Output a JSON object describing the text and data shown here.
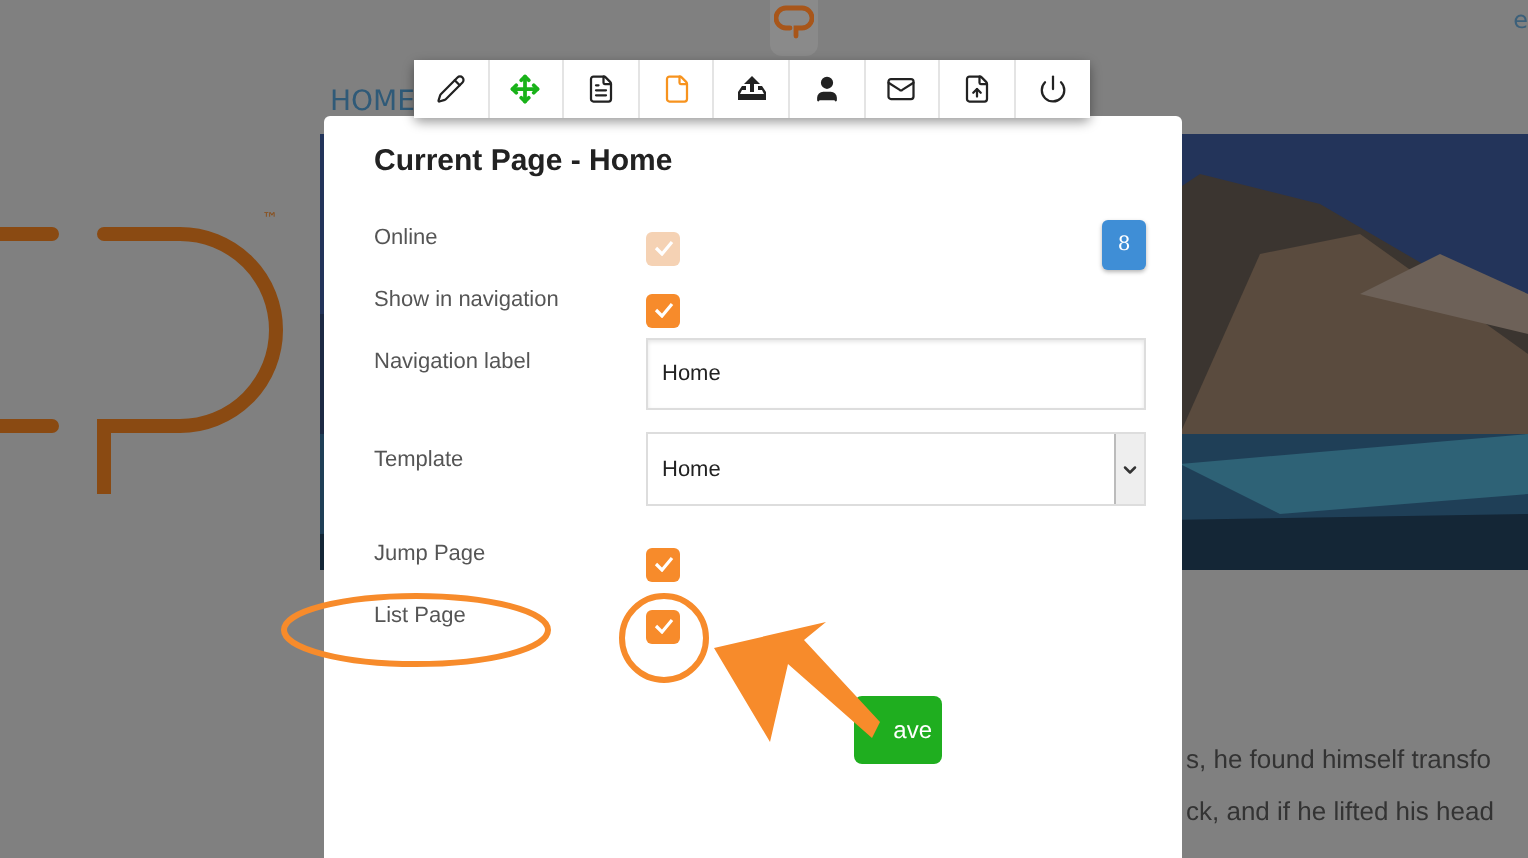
{
  "page": {
    "corner_text": "e",
    "nav_link": "HOME",
    "trademark": "™",
    "text_lines": [
      "s, he found himself transfo",
      "ck, and if he lifted his head"
    ]
  },
  "toolbar": [
    {
      "kind": "edit",
      "selected": false
    },
    {
      "kind": "move",
      "selected": false
    },
    {
      "kind": "document",
      "selected": false
    },
    {
      "kind": "page",
      "selected": true
    },
    {
      "kind": "upload",
      "selected": false
    },
    {
      "kind": "user",
      "selected": false
    },
    {
      "kind": "mail",
      "selected": false
    },
    {
      "kind": "file-upload",
      "selected": false
    },
    {
      "kind": "power",
      "selected": false
    }
  ],
  "dialog": {
    "title": "Current Page - Home",
    "badge": "8",
    "fields": [
      {
        "kind": "checkbox",
        "label": "Online",
        "checked": true,
        "disabled": true
      },
      {
        "kind": "checkbox",
        "label": "Show in navigation",
        "checked": true,
        "disabled": false
      },
      {
        "kind": "text",
        "label": "Navigation label",
        "value": "Home"
      },
      {
        "kind": "select",
        "label": "Template",
        "value": "Home"
      },
      {
        "kind": "checkbox",
        "label": "Jump Page",
        "checked": true,
        "disabled": false
      },
      {
        "kind": "checkbox",
        "label": "List Page",
        "checked": true,
        "disabled": false
      }
    ],
    "save_button": "ave"
  }
}
